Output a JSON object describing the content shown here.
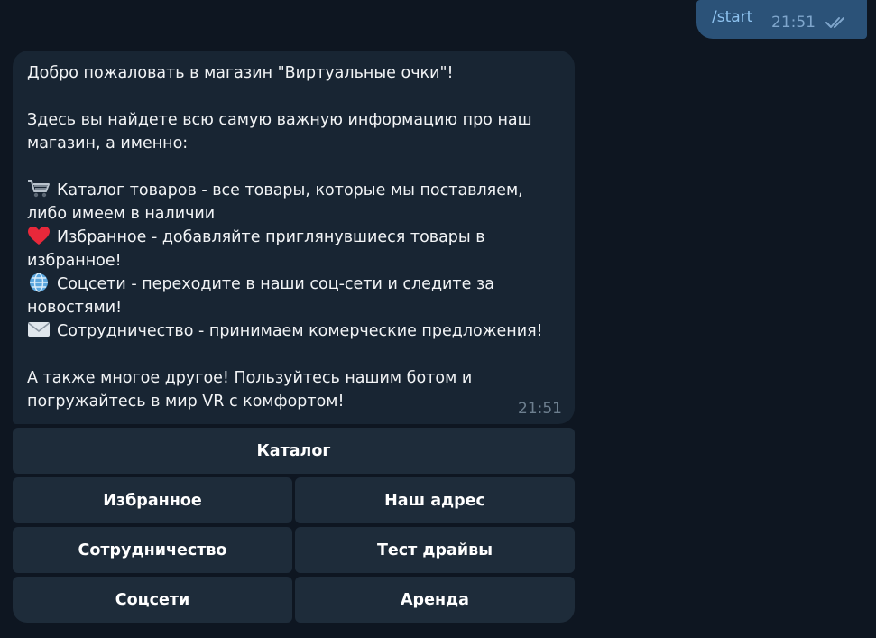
{
  "outgoing": {
    "text": "/start",
    "time": "21:51",
    "status_icon": "double-check-icon"
  },
  "incoming": {
    "lines": [
      "Добро пожаловать в магазин \"Виртуальные очки\"!",
      "",
      "Здесь вы найдете всю самую важную информацию про наш",
      "магазин, а именно:",
      "",
      "Каталог товаров - все товары, которые мы поставляем,",
      "либо имеем в наличии",
      "Избранное - добавляйте приглянувшиеся товары в",
      "избранное!",
      "Соцсети - переходите в наши соц-сети и следите за",
      "новостями!",
      "Сотрудничество - принимаем комерческие предложения!",
      "",
      "А также многое другое! Пользуйтесь нашим ботом и",
      "погружайтесь в мир VR с комфортом!"
    ],
    "time": "21:51",
    "icons": [
      "shopping-cart-icon",
      "heart-icon",
      "globe-icon",
      "envelope-icon"
    ]
  },
  "keyboard": {
    "catalog": "Каталог",
    "favorites": "Избранное",
    "address": "Наш адрес",
    "cooperation": "Сотрудничество",
    "test_drives": "Тест драйвы",
    "socials": "Соцсети",
    "rent": "Аренда"
  },
  "colors": {
    "background": "#0e1621",
    "outgoing_bubble": "#2b5278",
    "incoming_bubble": "#182533",
    "button": "#1e2c3a",
    "accent": "#8ec3f0"
  }
}
